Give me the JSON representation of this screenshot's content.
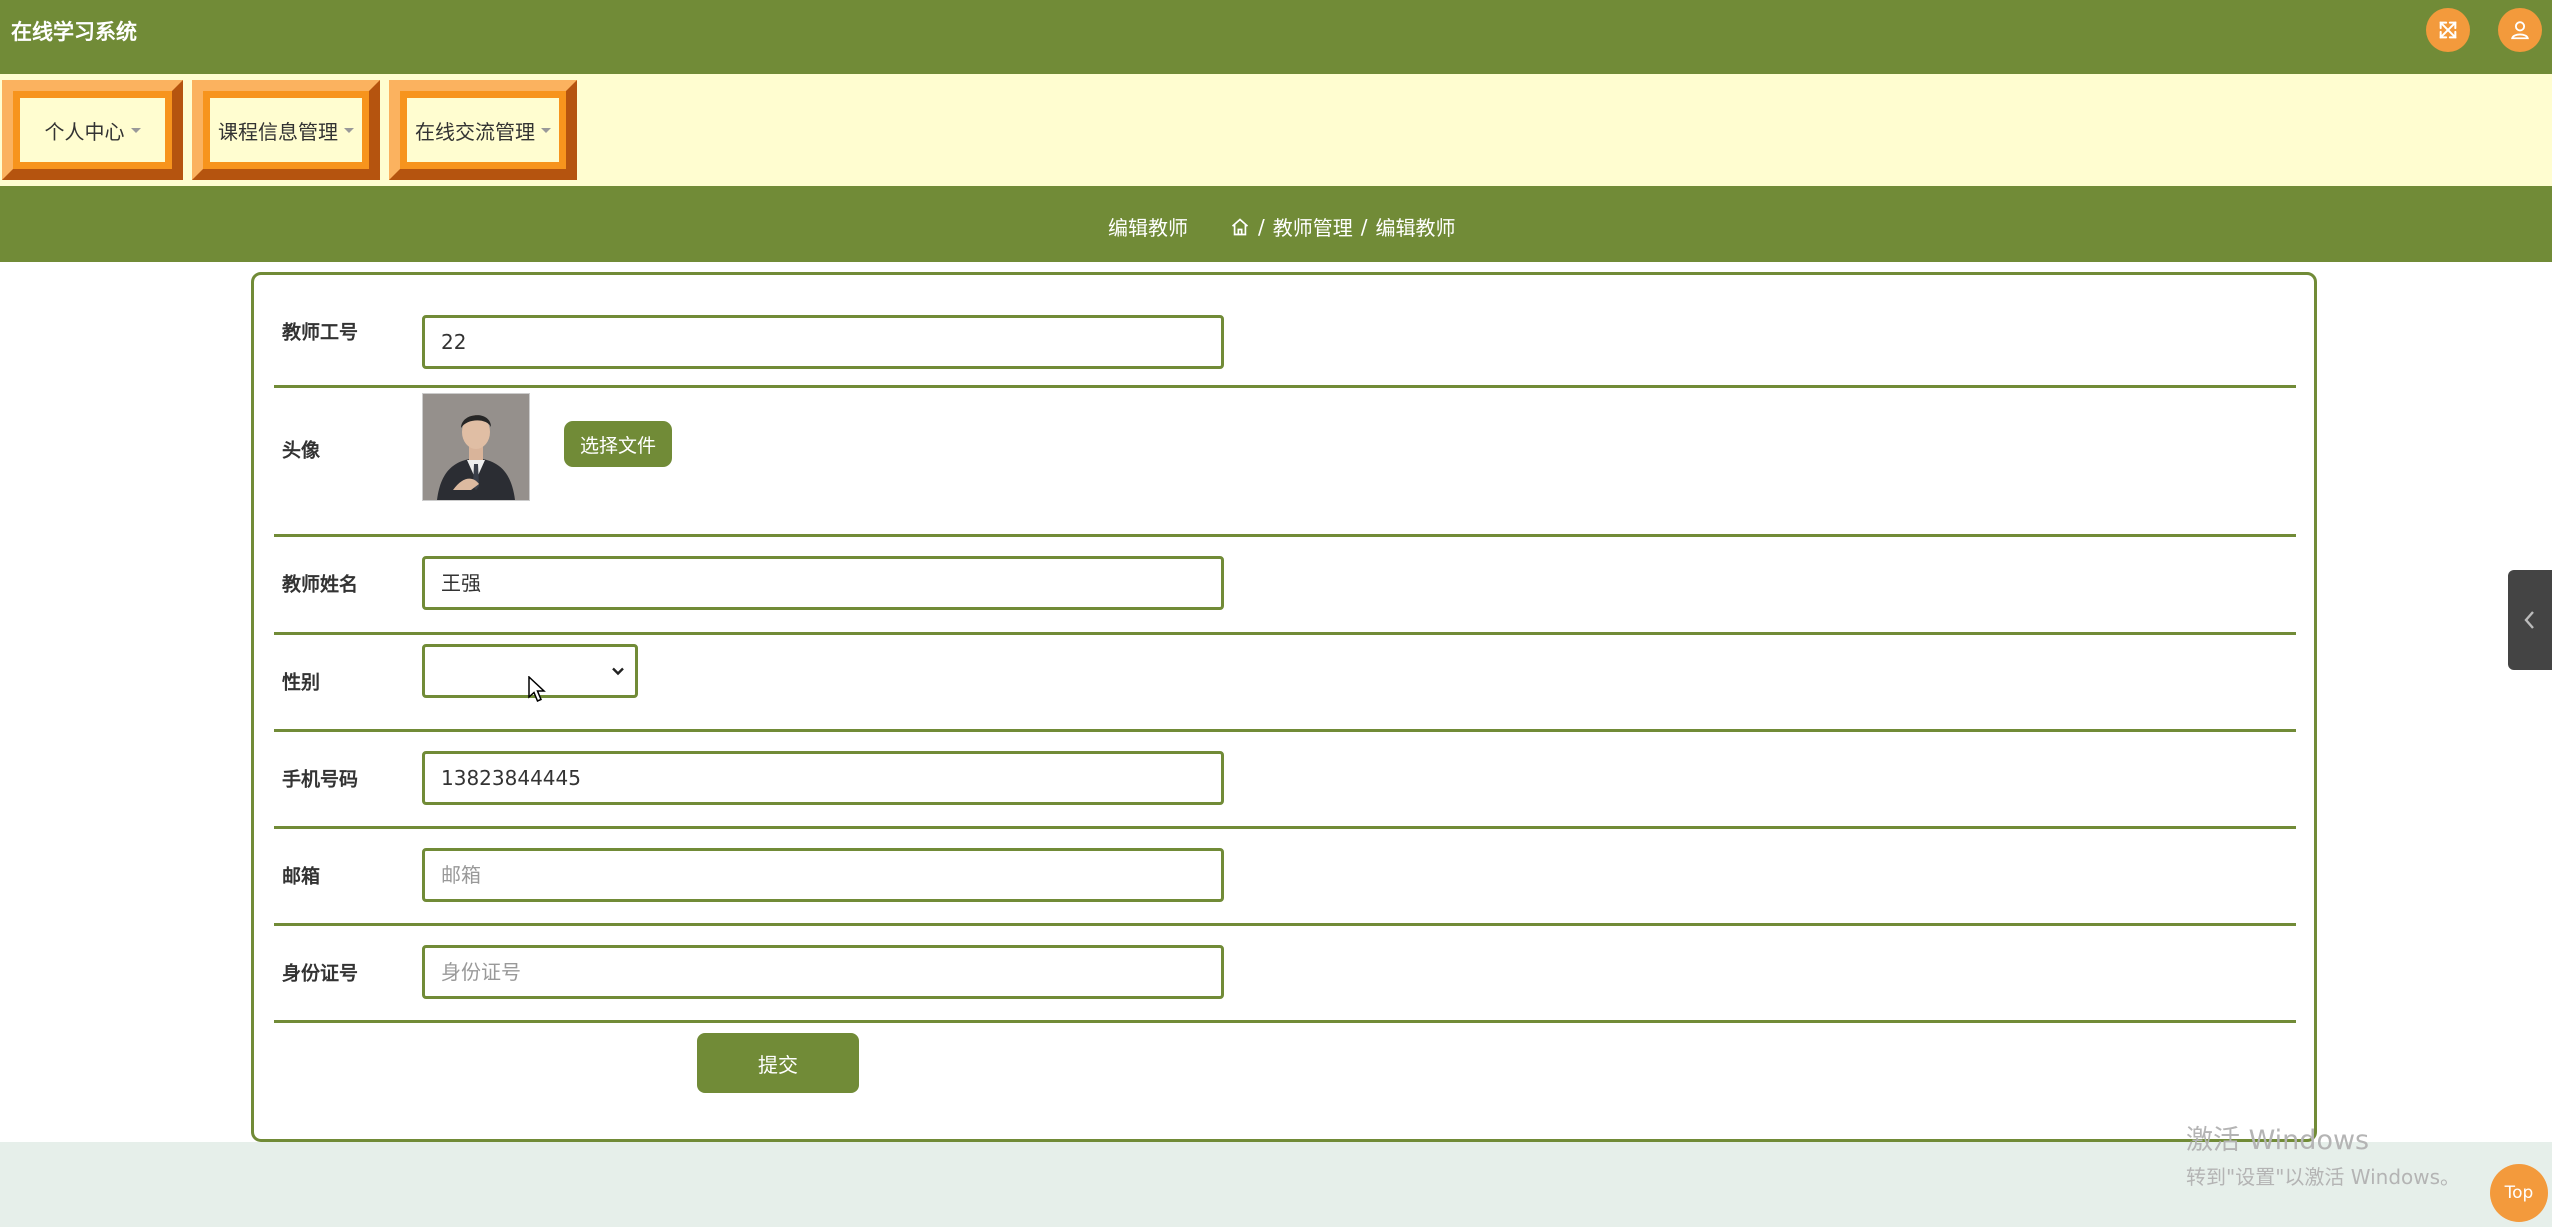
{
  "app": {
    "title": "在线学习系统"
  },
  "header_icons": [
    "expand-icon",
    "user-icon"
  ],
  "menu": {
    "items": [
      {
        "label": "个人中心"
      },
      {
        "label": "课程信息管理"
      },
      {
        "label": "在线交流管理"
      }
    ]
  },
  "breadcrumb": {
    "title": "编辑教师",
    "separator": "/",
    "path": [
      "教师管理",
      "编辑教师"
    ]
  },
  "form": {
    "teacher_id": {
      "label": "教师工号",
      "value": "22"
    },
    "avatar": {
      "label": "头像",
      "button": "选择文件"
    },
    "teacher_name": {
      "label": "教师姓名",
      "value": "王强"
    },
    "gender": {
      "label": "性别",
      "value": ""
    },
    "phone": {
      "label": "手机号码",
      "value": "13823844445"
    },
    "email": {
      "label": "邮箱",
      "value": "",
      "placeholder": "邮箱"
    },
    "id_card": {
      "label": "身份证号",
      "value": "",
      "placeholder": "身份证号"
    },
    "submit": "提交"
  },
  "floating": {
    "top_label": "Top"
  },
  "watermark": {
    "line1": "激活 Windows",
    "line2": "转到\"设置\"以激活 Windows。"
  },
  "colors": {
    "primary": "#718b37",
    "accent": "#f39a3c",
    "menu_bg": "#fffdd0",
    "footer": "#e6efea"
  }
}
